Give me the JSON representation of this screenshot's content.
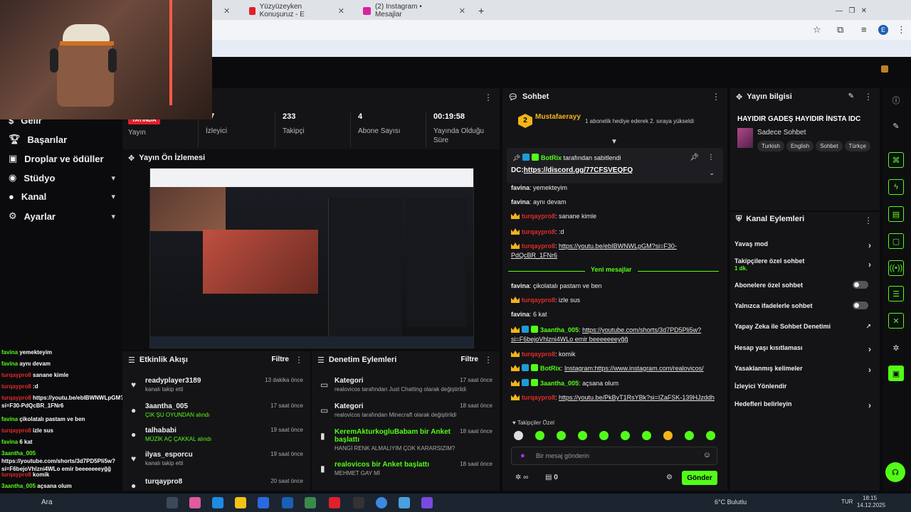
{
  "browser": {
    "tabs": [
      {
        "label": "Yüzyüzeyken Konuşuruz - E",
        "color": "#e0202a"
      },
      {
        "label": "(2) Instagram • Mesajlar",
        "color": "#d6249f"
      }
    ],
    "new_tab": "+",
    "profile": "E"
  },
  "nav": {
    "items": [
      {
        "label": "Gelir",
        "icon": "dollar-icon"
      },
      {
        "label": "Başarılar",
        "icon": "trophy-icon"
      },
      {
        "label": "Droplar ve ödüller",
        "icon": "gift-icon"
      },
      {
        "label": "Stüdyo",
        "icon": "studio-icon"
      },
      {
        "label": "Kanal",
        "icon": "person-icon"
      },
      {
        "label": "Ayarlar",
        "icon": "gear-icon"
      }
    ]
  },
  "stats": {
    "live": "YAYINDA",
    "items": [
      {
        "value": "",
        "label": "Yayın"
      },
      {
        "value": "17",
        "label": "İzleyici"
      },
      {
        "value": "233",
        "label": "Takipçi"
      },
      {
        "value": "4",
        "label": "Abone Sayısı"
      },
      {
        "value": "00:19:58",
        "label": "Yayında Olduğu Süre"
      }
    ]
  },
  "preview": {
    "title": "Yayın Ön İzlemesi"
  },
  "activity": {
    "title": "Etkinlik Akışı",
    "filter": "Filtre",
    "rows": [
      {
        "name": "readyplayer3189",
        "sub": "kanalı takip etti",
        "time": "13 dakika önce",
        "green": false
      },
      {
        "name": "3aantha_005",
        "sub": "ÇIK ŞU OYUNDAN alındı",
        "time": "17 saat önce",
        "green": true
      },
      {
        "name": "talhababi",
        "sub": "MÜZİK AÇ ÇAKKAL alındı",
        "time": "19 saat önce",
        "green": true
      },
      {
        "name": "ilyas_esporcu",
        "sub": "kanalı takip etti",
        "time": "19 saat önce",
        "green": false
      },
      {
        "name": "turqaypro8",
        "sub": "",
        "time": "20 saat önce",
        "green": false
      }
    ]
  },
  "modlog": {
    "title": "Denetim Eylemleri",
    "filter": "Filtre",
    "rows": [
      {
        "title": "Kategori",
        "sub": "realovicos tarafından Just Chatting olarak değiştirildi",
        "time": "17 saat önce"
      },
      {
        "title": "Kategori",
        "sub": "realovicos tarafından Minecraft olarak değiştirildi",
        "time": "18 saat önce"
      },
      {
        "title": "KeremAkturkogluBabam bir Anket başlattı",
        "sub": "HANGİ RENK ALMALIYIM ÇOK KARARSIZIM?",
        "time": "18 saat önce"
      },
      {
        "title": "realovicos bir Anket başlattı",
        "sub": "MEHMET GAY Mİ",
        "time": "18 saat önce"
      }
    ]
  },
  "overlay_chat": [
    {
      "user": "favina",
      "msg": "yemektеyim",
      "red": false
    },
    {
      "user": "favina",
      "msg": "aynı devam",
      "red": false
    },
    {
      "user": "turqaypro8",
      "msg": "sanane kimle",
      "red": true
    },
    {
      "user": "turqaypro8",
      "msg": ":d",
      "red": true
    },
    {
      "user": "turqaypro8",
      "msg": "https://youtu.be/ebIBWNWLpGM?si=F30-PdQcBR_1FNr6",
      "red": true
    },
    {
      "user": "favina",
      "msg": "çikolatalı pastam ve ben",
      "red": false
    },
    {
      "user": "turqaypro8",
      "msg": "izle sus",
      "red": true
    },
    {
      "user": "favina",
      "msg": "6 kat",
      "red": false
    },
    {
      "user": "3aantha_005",
      "msg": "https://youtube.com/shorts/3d7PD5Pli5w?si=F6bejoVhlzni4WLo emir beeeeeeeyğğ",
      "red": false
    },
    {
      "user": "turqaypro8",
      "msg": "komik",
      "red": true
    },
    {
      "user": "3aantha_005",
      "msg": "açsana olum",
      "red": false
    }
  ],
  "chat": {
    "title": "Sohbet",
    "top_user": "Mustafaerayy",
    "top_rank": "2",
    "top_notice": "1 abonelik hediye ederek 2. sıraya yükseldi",
    "pinned_by": "BotRix",
    "pinned_suffix": "tarafından sabitlendi",
    "pinned_text": "DC:",
    "pinned_link": "https://discord.gg/77CFSVEQFQ",
    "messages": [
      {
        "user": "favina",
        "text": "yemektеyim",
        "kind": "plain"
      },
      {
        "user": "favina",
        "text": "aynı devam",
        "kind": "plain"
      },
      {
        "user": "turqaypro8",
        "text": "sanane kimle",
        "kind": "red"
      },
      {
        "user": "turqaypro8",
        "text": ":d",
        "kind": "red"
      },
      {
        "user": "turqaypro8",
        "text": "https://youtu.be/ebIBWNWLpGM?si=F30-PdQcBR_1FNr6",
        "kind": "red-link"
      }
    ],
    "new_label": "Yeni mesajlar",
    "messages2": [
      {
        "user": "favina",
        "text": "çikolatalı pastam ve ben",
        "kind": "plain"
      },
      {
        "user": "turqaypro8",
        "text": "izle sus",
        "kind": "red"
      },
      {
        "user": "favina",
        "text": "6 kat",
        "kind": "plain"
      },
      {
        "user": "3aantha_005",
        "text": "https://youtube.com/shorts/3d7PD5Pli5w?si=F6bejoVhlzni4WLo emir beeeeeeeyğğ",
        "kind": "green-link"
      },
      {
        "user": "turqaypro8",
        "text": "komik",
        "kind": "red"
      },
      {
        "user": "BotRix",
        "text": "Instagram:https://www.instagram.com/realovicos/",
        "kind": "green-link"
      },
      {
        "user": "3aantha_005",
        "text": "açsana olum",
        "kind": "green"
      },
      {
        "user": "turqaypro8",
        "text": "https://youtu.be/PkByT1RsYBk?si=IZaFSK-139HJzddh",
        "kind": "red-link"
      }
    ],
    "followers_only": "Takipçiler Özel",
    "input_placeholder": "Bir mesaj gönderin",
    "points": "0",
    "send": "Gönder"
  },
  "stream_info": {
    "title": "Yayın bilgisi",
    "stream_title": "HAYIDIR GADEŞ HAYIDIR İNSTA IDC",
    "category": "Sadece Sohbet",
    "tags": [
      "Turkish",
      "English",
      "Sohbet",
      "Türkçe"
    ]
  },
  "channel_actions": {
    "title": "Kanal Eylemleri",
    "items": [
      {
        "label": "Yavaş mod",
        "sub": "",
        "control": "chevron"
      },
      {
        "label": "Takipçilere özel sohbet",
        "sub": "1 dk.",
        "control": "chevron"
      },
      {
        "label": "Abonelere özel sohbet",
        "sub": "",
        "control": "toggle"
      },
      {
        "label": "Yalnızca ifadelerle sohbet",
        "sub": "",
        "control": "toggle"
      },
      {
        "label": "Yapay Zeka ile Sohbet Denetimi",
        "sub": "",
        "control": "external"
      },
      {
        "label": "Hesap yaşı kısıtlaması",
        "sub": "",
        "control": "chevron"
      },
      {
        "label": "Yasaklanmış kelimeler",
        "sub": "",
        "control": "chevron"
      },
      {
        "label": "İzleyici Yönlendir",
        "sub": "",
        "control": "none"
      },
      {
        "label": "Hedefleri belirleyin",
        "sub": "",
        "control": "chevron"
      }
    ]
  },
  "taskbar": {
    "search": "Ara",
    "weather": "6°C Bulutlu",
    "lang": "TUR",
    "time": "18:15",
    "date": "14.12.2025"
  },
  "colors": {
    "accent": "#53fc18",
    "red": "#e02a2a",
    "gold": "#f2b418"
  }
}
